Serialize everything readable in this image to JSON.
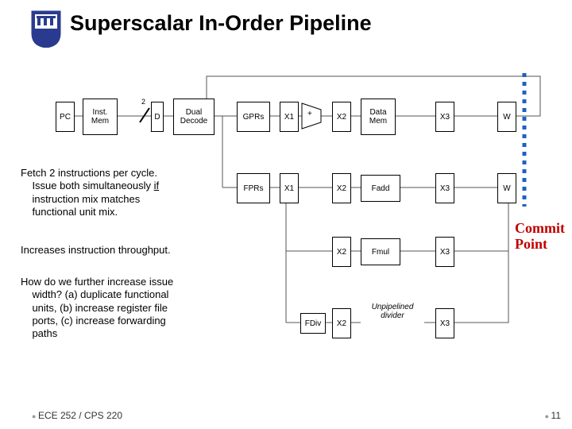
{
  "title": "Superscalar In-Order Pipeline",
  "footer": "ECE 252 / CPS 220",
  "slidenum": "11",
  "width_label": "2",
  "commit": "Commit\nPoint",
  "stages": {
    "pc": "PC",
    "imem": "Inst.\nMem",
    "d": "D",
    "decode": "Dual\nDecode",
    "gprs": "GPRs",
    "fprs": "FPRs",
    "x1": "X1",
    "plus": "+",
    "x2": "X2",
    "dmem": "Data\nMem",
    "fadd": "Fadd",
    "fmul": "Fmul",
    "fdiv": "FDiv",
    "unpipe": "Unpipelined\ndivider",
    "x3": "X3",
    "w": "W"
  },
  "text": {
    "p1": "Fetch 2 instructions per cycle.\n    Issue both simultaneously if\n    instruction mix matches\n    functional unit mix.",
    "p2": "Increases instruction throughput.",
    "p3": "How do we further increase issue\n    width? (a) duplicate functional\n    units, (b) increase register file\n    ports, (c) increase forwarding\n    paths"
  }
}
